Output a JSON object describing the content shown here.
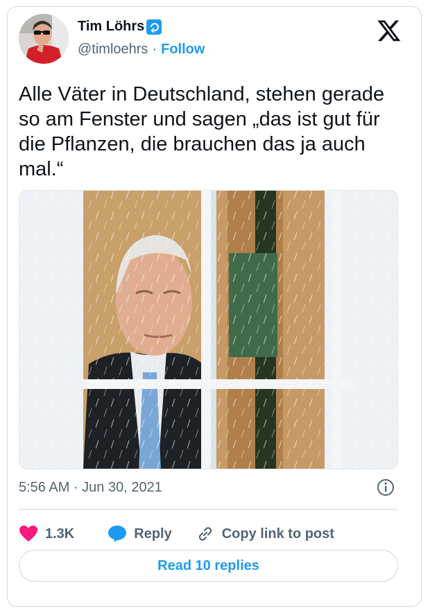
{
  "author": {
    "name": "Tim Löhrs",
    "handle": "@timloehrs",
    "separator": "·",
    "follow_label": "Follow",
    "avatar_icon": "profile-photo",
    "badge_icon": "repost-badge-icon"
  },
  "platform_logo": "x-logo-icon",
  "tweet": {
    "text": "Alle Väter in Deutschland, stehen gerade so am Fenster und sagen „das ist gut für die Pflanzen, die brauchen das ja auch mal.“",
    "media_description_icon": "photo-man-at-rainy-window",
    "timestamp": "5:56 AM · Jun 30, 2021"
  },
  "actions": {
    "likes": "1.3K",
    "reply_label": "Reply",
    "copy_link_label": "Copy link to post"
  },
  "read_replies_label": "Read 10 replies",
  "colors": {
    "accent": "#1d9bf0",
    "like": "#f91880",
    "text_secondary": "#536471",
    "border": "#cfd9de"
  }
}
